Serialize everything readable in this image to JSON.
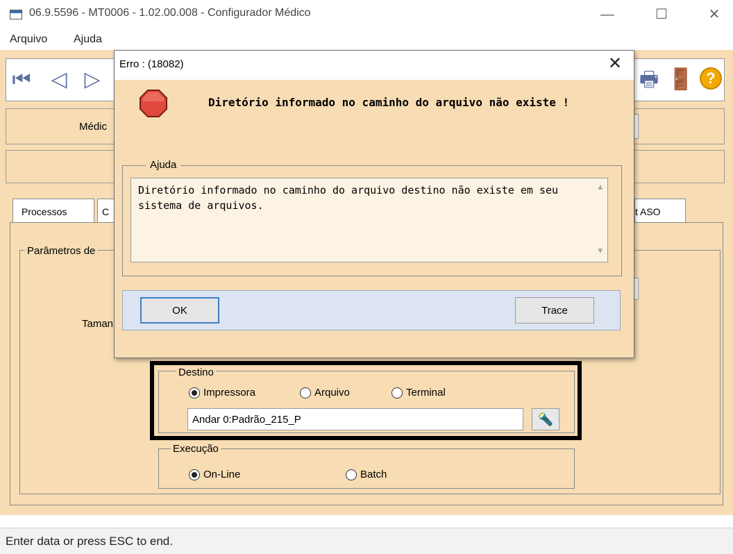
{
  "window": {
    "title": "06.9.5596 - MT0006 - 1.02.00.008 - Configurador Médico",
    "minimize": "—",
    "maximize": "☐",
    "close": "✕"
  },
  "menu": {
    "arquivo": "Arquivo",
    "ajuda": "Ajuda"
  },
  "form": {
    "medico_label": "Médic",
    "tabs": [
      "Processos",
      "C",
      "t ASO"
    ],
    "params_legend": "Parâmetros de",
    "tamanho_label": "Taman",
    "destino": {
      "legend": "Destino",
      "options": [
        "Impressora",
        "Arquivo",
        "Terminal"
      ],
      "selected": "Impressora",
      "path_value": "Andar 0:Padrão_215_P"
    },
    "execucao": {
      "legend": "Execução",
      "options": [
        "On-Line",
        "Batch"
      ],
      "selected": "On-Line"
    }
  },
  "dialog": {
    "title": "Erro : (18082)",
    "close": "✕",
    "message": "Diretório informado no caminho do arquivo não existe !",
    "ajuda_legend": "Ajuda",
    "ajuda_text": "Diretório informado no caminho do arquivo destino não existe em seu sistema de arquivos.",
    "ok_label": "OK",
    "trace_label": "Trace"
  },
  "status": {
    "text": "Enter data or press ESC to end."
  },
  "icons": {
    "first": "⏮",
    "prev": "◁",
    "next": "▷",
    "print": "🖶",
    "exit": "🚪",
    "help": "?",
    "search": "🔦"
  }
}
